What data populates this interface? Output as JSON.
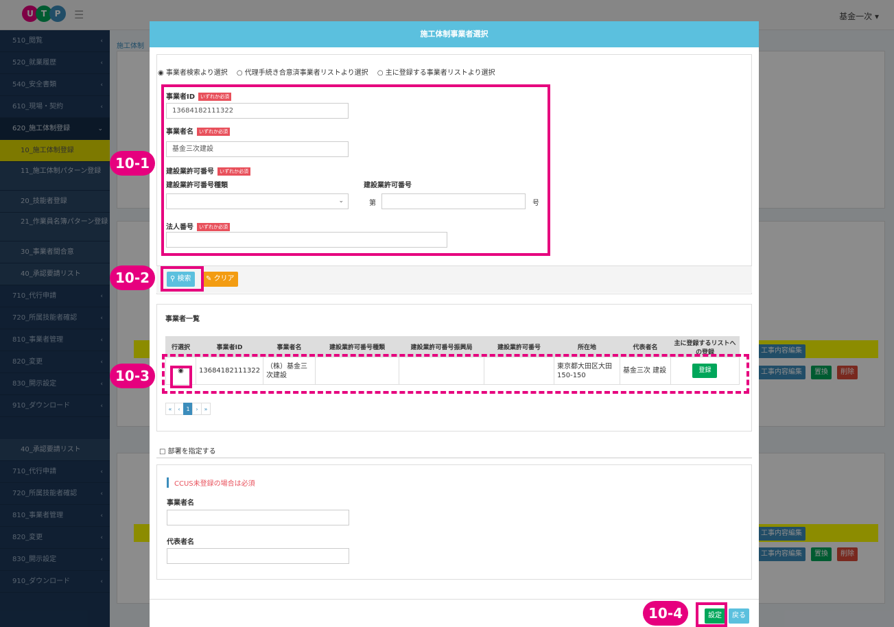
{
  "topbar": {
    "logo_letters": [
      "U",
      "T",
      "P"
    ],
    "user": "基金一次 ▾"
  },
  "sidebar": {
    "items": [
      {
        "label": "510_閲覧"
      },
      {
        "label": "520_就業履歴"
      },
      {
        "label": "540_安全書類"
      },
      {
        "label": "610_現場・契約"
      },
      {
        "label": "620_施工体制登録"
      },
      {
        "label": "10_施工体制登録"
      },
      {
        "label": "11_施工体制パターン登録"
      },
      {
        "label": "20_技能者登録"
      },
      {
        "label": "21_作業員名簿パターン登録"
      },
      {
        "label": "30_事業者間合意"
      },
      {
        "label": "40_承認要請リスト"
      },
      {
        "label": "710_代行申請"
      },
      {
        "label": "720_所属技能者確認"
      },
      {
        "label": "810_事業者管理"
      },
      {
        "label": "820_変更"
      },
      {
        "label": "830_開示設定"
      },
      {
        "label": "910_ダウンロード"
      }
    ],
    "items2": [
      {
        "label": "40_承認要請リスト"
      },
      {
        "label": "710_代行申請"
      },
      {
        "label": "720_所属技能者確認"
      },
      {
        "label": "810_事業者管理"
      },
      {
        "label": "820_変更"
      },
      {
        "label": "830_開示設定"
      },
      {
        "label": "910_ダウンロード"
      }
    ]
  },
  "background": {
    "breadcrumb": "施工体制",
    "edit_label": "工事内容編集",
    "replace_label": "置換",
    "delete_label": "削除"
  },
  "modal": {
    "title": "施工体制事業者選択",
    "radio_options": [
      "◉ 事業者検索より選択",
      "○ 代理手続き合意済事業者リストより選択",
      "○ 主に登録する事業者リストより選択"
    ],
    "req_tag": "いずれか必須",
    "fields": {
      "id_label": "事業者ID",
      "id_value": "13684182111322",
      "name_label": "事業者名",
      "name_value": "基金三次建設",
      "permit_label": "建設業許可番号",
      "permit_type_label": "建設業許可番号種類",
      "permit_no_label": "建設業許可番号",
      "dai": "第",
      "go": "号",
      "corp_label": "法人番号"
    },
    "search_btn": "検索",
    "clear_btn": "クリア",
    "list_title": "事業者一覧",
    "table_headers": [
      "行選択",
      "事業者ID",
      "事業者名",
      "建設業許可番号種類",
      "建設業許可番号振興局",
      "建設業許可番号",
      "所在地",
      "代表者名",
      "主に登録するリストへの登録"
    ],
    "row": {
      "select": "◉",
      "id": "13684182111322",
      "name": "（株）基金三次建設",
      "permit_type": "",
      "permit_bureau": "",
      "permit_no": "",
      "address": "東京都大田区大田150-150",
      "rep": "基金三次 建設",
      "reg_btn": "登録"
    },
    "pager": [
      "«",
      "‹",
      "1",
      "›",
      "»"
    ],
    "dept_check": "□ 部署を指定する",
    "note": "CCUS未登録の場合は必須",
    "biz_name_label": "事業者名",
    "rep_name_label": "代表者名",
    "set_btn": "設定",
    "back_btn": "戻る"
  },
  "annotations": {
    "m1": "10-1",
    "m2": "10-2",
    "m3": "10-3",
    "m4": "10-4"
  }
}
